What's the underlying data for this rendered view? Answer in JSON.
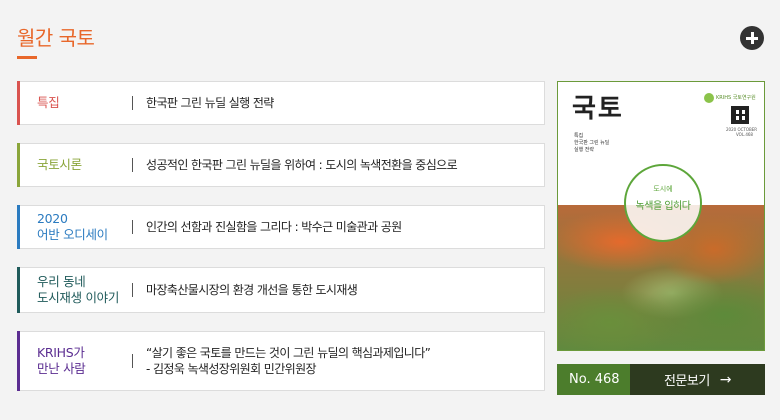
{
  "header": {
    "title": "월간 국토",
    "more_icon": "plus-circle-icon"
  },
  "items": [
    {
      "label": "특집",
      "text": "한국판 그린 뉴딜 실행 전략",
      "color": "#d9534f"
    },
    {
      "label": "국토시론",
      "text": "성공적인 한국판 그린 뉴딜을 위하여 : 도시의 녹색전환을 중심으로",
      "color": "#8aa53a"
    },
    {
      "label": "2020\n어반 오디세이",
      "text": "인간의 선함과 진실함을 그리다 : 박수근 미술관과 공원",
      "color": "#2b7bc0"
    },
    {
      "label": "우리 동네\n도시재생 이야기",
      "text": "마장축산물시장의 환경 개선을 통한 도시재생",
      "color": "#1f5a5a"
    },
    {
      "label": "KRIHS가\n만난 사람",
      "text": "“살기 좋은 국토를 만드는 것이 그린 뉴딜의 핵심과제입니다”\n- 김정욱 녹색성장위원회 민간위원장",
      "color": "#5b2d91"
    }
  ],
  "cover": {
    "title": "국토",
    "logo_text": "KRIHS 국토연구원",
    "date": "2020 OCTOBER",
    "vol": "VOL.468",
    "sub_line1": "특집",
    "sub_line2": "한국판 그린 뉴딜",
    "sub_line3": "실행 전략",
    "circle_small": "도시에",
    "circle_big": "녹색을 입히다"
  },
  "issue": {
    "number": "No. 468",
    "link_label": "전문보기",
    "arrow": "→"
  }
}
